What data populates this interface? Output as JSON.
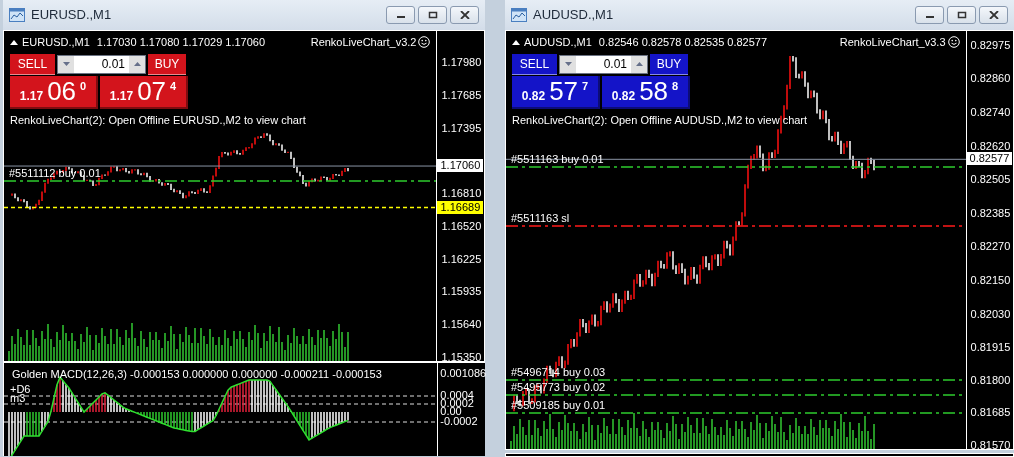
{
  "windows": [
    {
      "title": "EURUSD.,M1",
      "symbol": "EURUSD.,M1",
      "ohlc": "1.17030 1.17080 1.17029 1.17060",
      "indicator": "RenkoLiveChart_v3.2",
      "trade_panel": {
        "color": "#d3141c",
        "sell_label": "SELL",
        "buy_label": "BUY",
        "lot": "0.01",
        "sell_price": {
          "prefix": "1.17",
          "pips": "06",
          "fraction": "0"
        },
        "buy_price": {
          "prefix": "1.17",
          "pips": "07",
          "fraction": "4"
        }
      },
      "message": "RenkoLiveChart(2): Open Offline EURUSD.,M2 to view chart",
      "price_axis": [
        "1.17980",
        "1.17685",
        "1.17395",
        "1.16810",
        "1.16520",
        "1.16225",
        "1.15935",
        "1.15640",
        "1.15350"
      ],
      "price_tags": [
        {
          "label": "1.17060",
          "kind": "bid"
        },
        {
          "label": "1.16689",
          "kind": "alert"
        }
      ],
      "order_lines": [
        {
          "label": "#5511112 buy 0.01",
          "kind": "entry"
        }
      ],
      "subwindow": {
        "title": "Golden MACD(12,26,3) -0.000153 0.000000 0.000000 -0.000211 -0.000153",
        "labels": [
          "+D6",
          "m3"
        ],
        "axis": [
          "0.001086",
          "0.0004",
          "0.0002",
          "0.00",
          "-0.0002"
        ]
      }
    },
    {
      "title": "AUDUSD.,M1",
      "symbol": "AUDUSD.,M1",
      "ohlc": "0.82546 0.82578 0.82535 0.82577",
      "indicator": "RenkoLiveChart_v3.3",
      "trade_panel": {
        "color": "#1414c8",
        "sell_label": "SELL",
        "buy_label": "BUY",
        "lot": "0.01",
        "sell_price": {
          "prefix": "0.82",
          "pips": "57",
          "fraction": "7"
        },
        "buy_price": {
          "prefix": "0.82",
          "pips": "58",
          "fraction": "8"
        }
      },
      "message": "RenkoLiveChart(2): Open Offline AUDUSD.,M2 to view chart",
      "price_axis": [
        "0.82975",
        "0.82860",
        "0.82740",
        "0.82620",
        "0.82505",
        "0.82385",
        "0.82270",
        "0.82150",
        "0.82030",
        "0.81915",
        "0.81800",
        "0.81685",
        "0.81570"
      ],
      "price_tags": [
        {
          "label": "0.82577",
          "kind": "bid"
        }
      ],
      "order_lines": [
        {
          "label": "#5511163 buy 0.01",
          "kind": "entry"
        },
        {
          "label": "#5511163 sl",
          "kind": "sl"
        },
        {
          "label": "#5496714 buy 0.03",
          "kind": "entry"
        },
        {
          "label": "#5495773 buy 0.02",
          "kind": "entry"
        },
        {
          "label": "#5509185 buy 0.01",
          "kind": "entry"
        }
      ]
    }
  ]
}
